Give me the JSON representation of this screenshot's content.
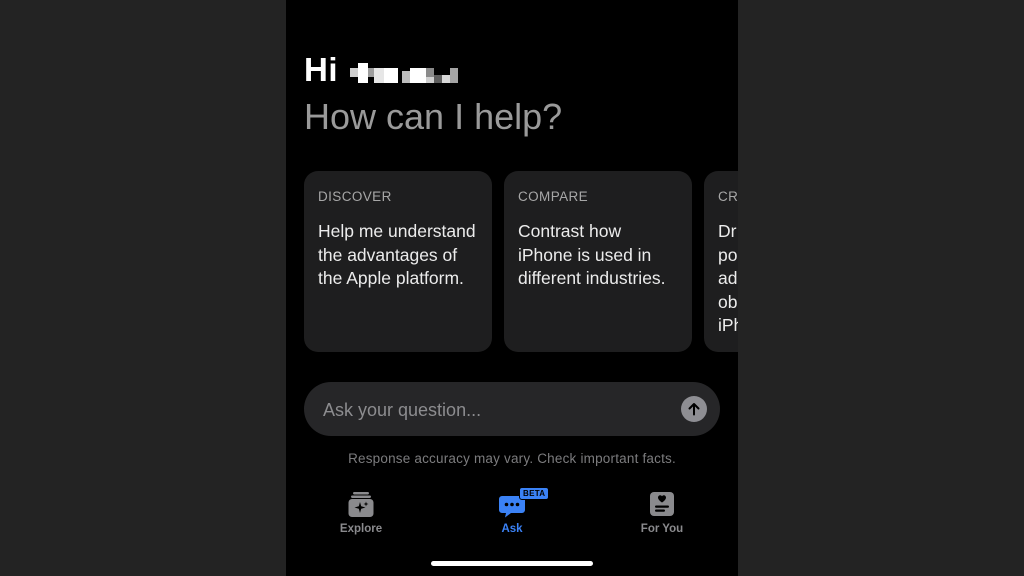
{
  "greeting": {
    "hi": "Hi"
  },
  "headline": "How can I help?",
  "cards": [
    {
      "category": "DISCOVER",
      "text": "Help me understand the advantages of the Apple platform."
    },
    {
      "category": "COMPARE",
      "text": "Contrast how iPhone is used in different industries."
    },
    {
      "category": "CRI",
      "text": "Dr po ad ob iPh"
    }
  ],
  "input": {
    "placeholder": "Ask your question..."
  },
  "disclaimer": "Response accuracy may vary. Check important facts.",
  "tabs": [
    {
      "label": "Explore",
      "icon": "explore-sparkle-icon",
      "active": false
    },
    {
      "label": "Ask",
      "icon": "chat-bubble-icon",
      "active": true,
      "badge": "BETA"
    },
    {
      "label": "For You",
      "icon": "heart-card-icon",
      "active": false
    }
  ],
  "colors": {
    "background": "#000000",
    "outer": "#232323",
    "card": "#1e1e1f",
    "accent": "#3b82f6",
    "inactive": "#8a8a8d"
  }
}
